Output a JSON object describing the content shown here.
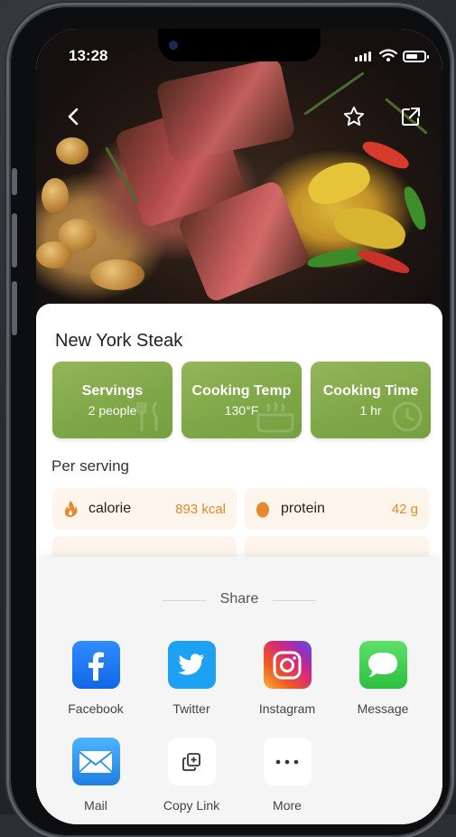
{
  "status_bar": {
    "time": "13:28"
  },
  "recipe": {
    "title": "New York Steak",
    "tiles": [
      {
        "title": "Servings",
        "value": "2 people"
      },
      {
        "title": "Cooking Temp",
        "value": "130°F"
      },
      {
        "title": "Cooking Time",
        "value": "1 hr"
      }
    ],
    "per_serving_label": "Per serving",
    "nutrition": [
      {
        "label": "calorie",
        "value": "893 kcal",
        "icon": "flame-icon"
      },
      {
        "label": "protein",
        "value": "42 g",
        "icon": "egg-icon"
      }
    ]
  },
  "share_sheet": {
    "title": "Share",
    "options": [
      {
        "label": "Facebook",
        "icon": "facebook-icon",
        "color": "#1877f2"
      },
      {
        "label": "Twitter",
        "icon": "twitter-icon",
        "color": "#1da1f2"
      },
      {
        "label": "Instagram",
        "icon": "instagram-icon",
        "color": "#d62976"
      },
      {
        "label": "Message",
        "icon": "message-icon",
        "color": "#34c759"
      },
      {
        "label": "Mail",
        "icon": "mail-icon",
        "color": "#2b8fe8"
      },
      {
        "label": "Copy Link",
        "icon": "copy-link-icon",
        "color": "#ffffff"
      },
      {
        "label": "More",
        "icon": "more-icon",
        "color": "#ffffff"
      }
    ]
  },
  "colors": {
    "tile_green": "#7ea646",
    "accent_orange": "#e38a2c"
  }
}
